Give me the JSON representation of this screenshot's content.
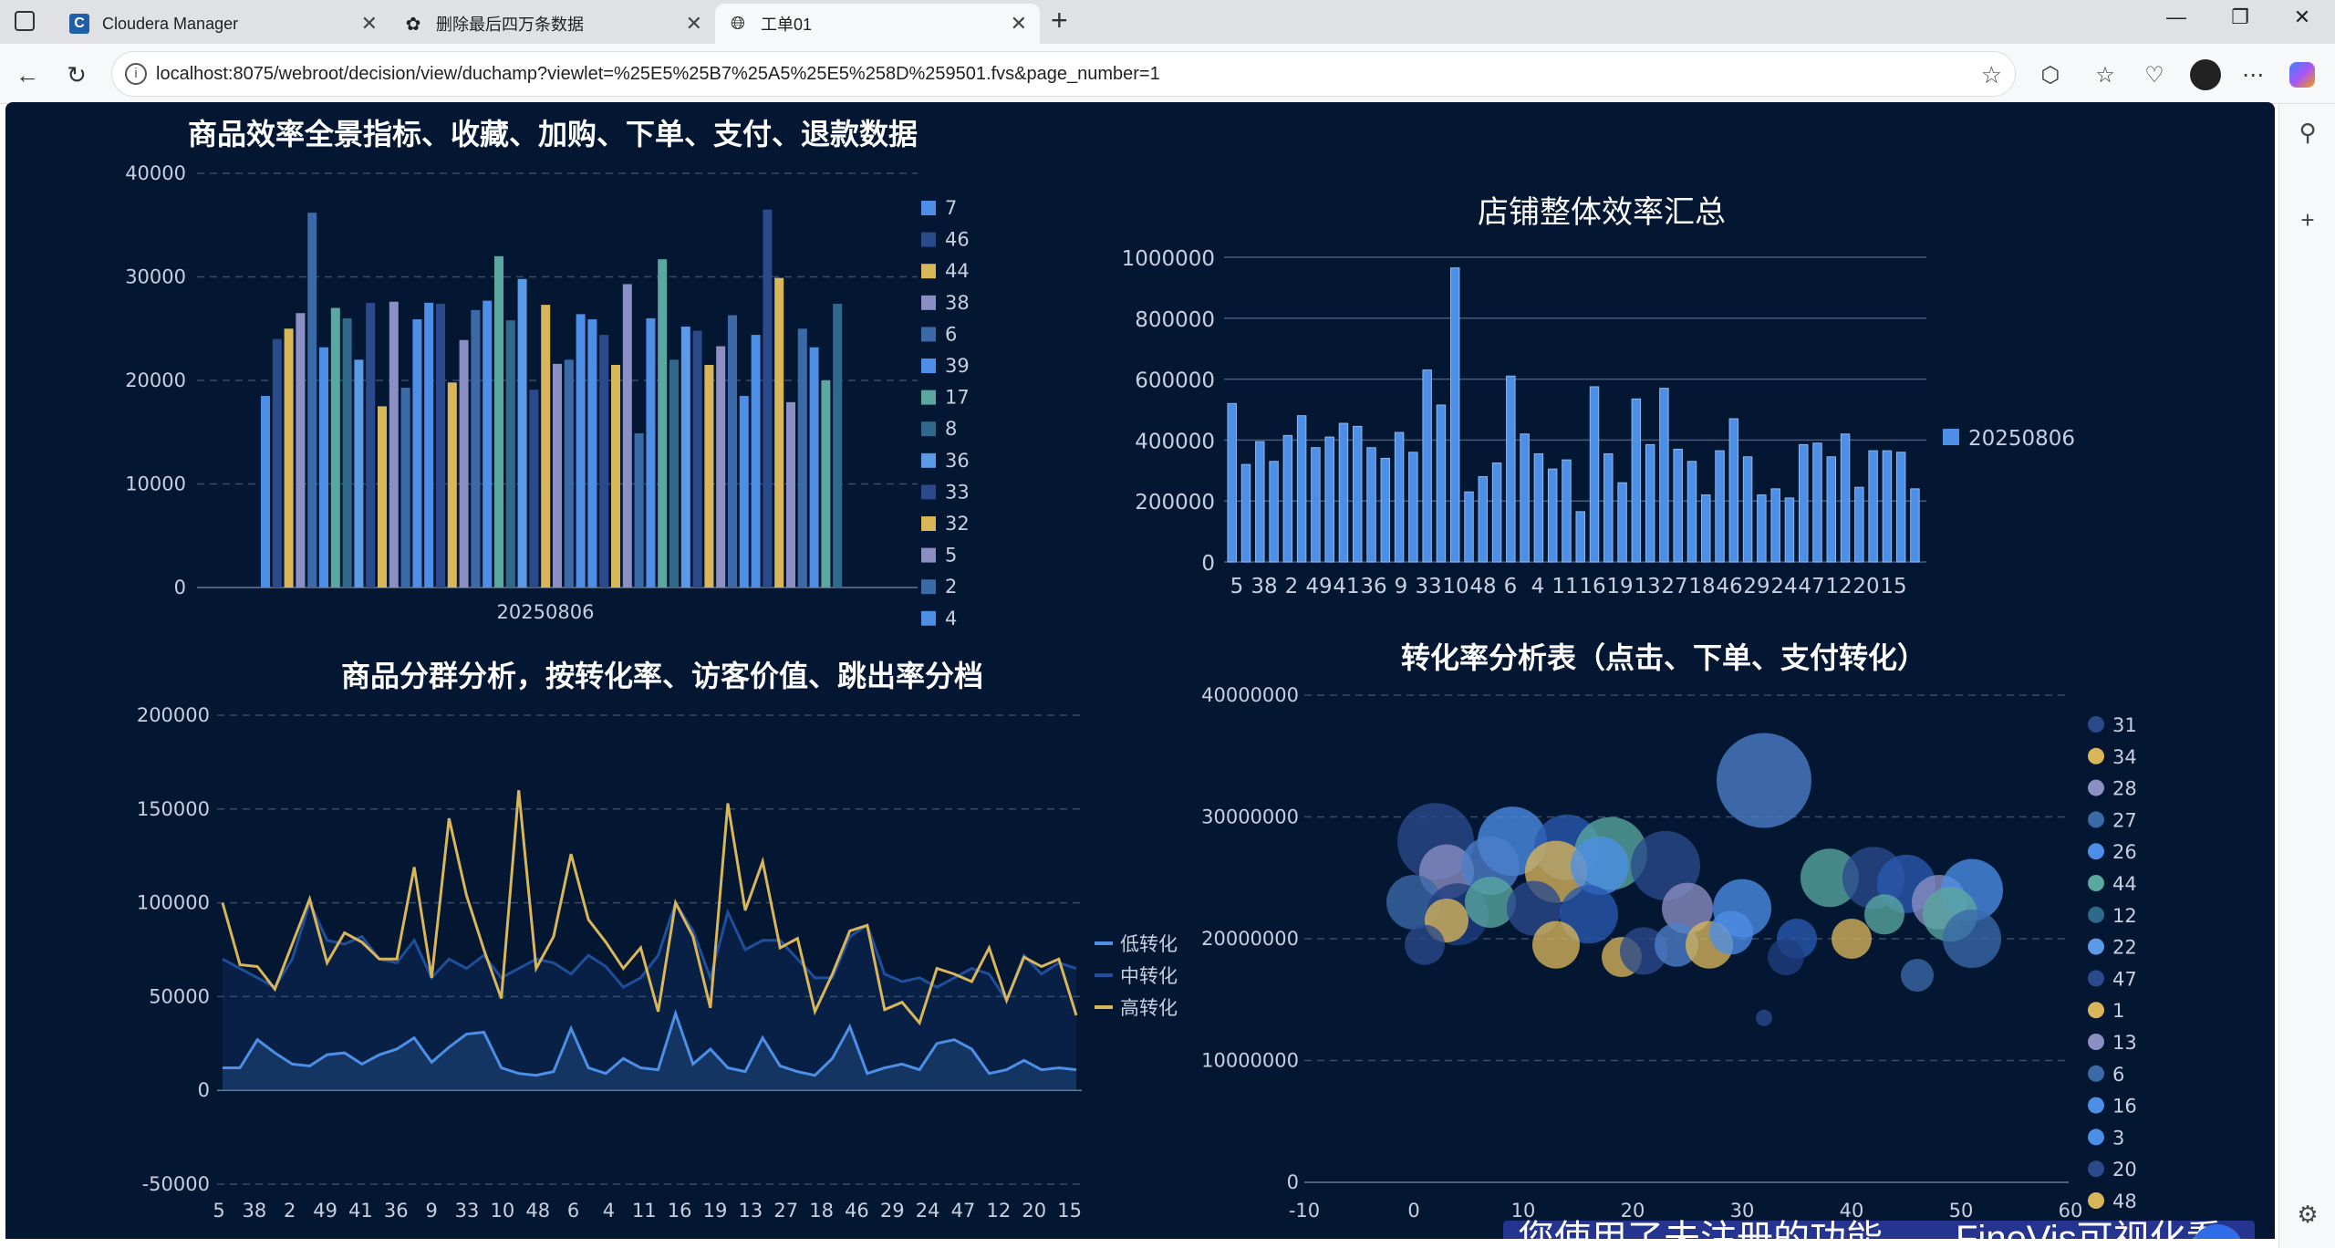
{
  "browser": {
    "tabs": [
      {
        "title": "Cloudera Manager",
        "icon": "cloudera-icon"
      },
      {
        "title": "删除最后四万条数据",
        "icon": "openai-icon"
      },
      {
        "title": "工单01",
        "icon": "globe-icon"
      }
    ],
    "new_tab_label": "+",
    "url": "localhost:8075/webroot/decision/view/duchamp?viewlet=%25E5%25B7%25A5%25E5%258D%259501.fvs&page_number=1"
  },
  "watermark_text": "您使用了未注册的功能——FineVis可视化看板",
  "colors": {
    "background": "#031632",
    "accent_blue": "#4d8ee6",
    "gold": "#d9b65a",
    "teal": "#5aa8a0",
    "lavender": "#8c8fc4",
    "navy": "#2a4a8c"
  },
  "chart_data": [
    {
      "id": "chart1",
      "type": "bar",
      "title": "商品效率全景指标、收藏、加购、下单、支付、退款数据",
      "categories": [
        "20250806"
      ],
      "ylim": [
        0,
        40000
      ],
      "yticks": [
        "40000",
        "30000",
        "20000",
        "10000",
        "0"
      ],
      "grid": true,
      "legend_position": "right",
      "legend": [
        "7",
        "46",
        "44",
        "38",
        "6",
        "39",
        "17",
        "8",
        "36",
        "33",
        "32",
        "5",
        "2",
        "4"
      ],
      "values": [
        18500,
        24000,
        25000,
        26500,
        36200,
        23200,
        27000,
        26000,
        22000,
        27500,
        17500,
        27600,
        19300,
        25900,
        27500,
        27400,
        19800,
        23900,
        26800,
        27700,
        32000,
        25800,
        29800,
        19100,
        27300,
        21600,
        22000,
        26400,
        25900,
        24400,
        21500,
        29300,
        14900,
        26000,
        31700,
        22000,
        25200,
        24800,
        21500,
        23300,
        26300,
        18500,
        24400,
        36500,
        29900,
        17900,
        25000,
        23200,
        20000,
        27400
      ]
    },
    {
      "id": "chart2",
      "type": "bar",
      "title": "店铺整体效率汇总",
      "series_name": "20250806",
      "categories": [
        "5",
        "38",
        "2",
        "49",
        "41",
        "36",
        "9",
        "33",
        "10",
        "48",
        "6",
        "4",
        "11",
        "16",
        "19",
        "13",
        "27",
        "18",
        "46",
        "29",
        "24",
        "47",
        "12",
        "20",
        "15"
      ],
      "ylim": [
        0,
        1000000
      ],
      "yticks": [
        "1000000",
        "800000",
        "600000",
        "400000",
        "200000",
        "0"
      ],
      "grid": true,
      "legend_position": "right",
      "values": [
        520000,
        320000,
        395000,
        330000,
        415000,
        480000,
        375000,
        410000,
        455000,
        445000,
        375000,
        340000,
        425000,
        360000,
        630000,
        515000,
        965000,
        230000,
        280000,
        325000,
        610000,
        420000,
        355000,
        305000,
        335000,
        165000,
        575000,
        355000,
        260000,
        535000,
        385000,
        570000,
        370000,
        330000,
        220000,
        365000,
        470000,
        345000,
        220000,
        240000,
        210000,
        385000,
        390000,
        345000,
        420000,
        245000,
        365000,
        365000,
        360000,
        240000
      ]
    },
    {
      "id": "chart3",
      "type": "line",
      "title": "商品分群分析，按转化率、访客价值、跳出率分档",
      "categories": [
        "5",
        "38",
        "2",
        "49",
        "41",
        "36",
        "9",
        "33",
        "10",
        "48",
        "6",
        "4",
        "11",
        "16",
        "19",
        "13",
        "27",
        "18",
        "46",
        "29",
        "24",
        "47",
        "12",
        "20",
        "15"
      ],
      "ylim": [
        -50000,
        200000
      ],
      "yticks": [
        "200000",
        "150000",
        "100000",
        "50000",
        "0",
        "-50000"
      ],
      "grid": true,
      "legend_position": "right",
      "series": [
        {
          "name": "低转化",
          "color": "#4d8ee6",
          "values": [
            12000,
            12000,
            27000,
            20000,
            14000,
            13000,
            19000,
            20000,
            14000,
            19000,
            22000,
            28000,
            15000,
            23000,
            30000,
            31000,
            12000,
            9000,
            8000,
            10000,
            33000,
            12000,
            9000,
            17000,
            12000,
            11000,
            41000,
            14000,
            22000,
            12000,
            10000,
            28000,
            13000,
            10000,
            8000,
            17000,
            34000,
            9000,
            12000,
            14000,
            11000,
            25000,
            27000,
            22000,
            9000,
            11000,
            16000,
            11000,
            12000,
            11000
          ]
        },
        {
          "name": "中转化",
          "color": "#1f4f9a",
          "values": [
            70000,
            65000,
            60000,
            55000,
            70000,
            100000,
            80000,
            78000,
            82000,
            70000,
            68000,
            80000,
            60000,
            70000,
            65000,
            72000,
            60000,
            65000,
            70000,
            68000,
            62000,
            72000,
            66000,
            55000,
            60000,
            72000,
            100000,
            85000,
            60000,
            95000,
            75000,
            80000,
            80000,
            70000,
            60000,
            60000,
            82000,
            88000,
            62000,
            58000,
            60000,
            55000,
            60000,
            65000,
            62000,
            48000,
            72000,
            62000,
            68000,
            65000
          ]
        },
        {
          "name": "高转化",
          "color": "#d9b65a",
          "values": [
            100000,
            67000,
            66000,
            54000,
            78000,
            102000,
            68000,
            84000,
            79000,
            70000,
            70000,
            119000,
            60000,
            145000,
            104000,
            75000,
            49000,
            160000,
            65000,
            82000,
            126000,
            91000,
            79000,
            65000,
            76000,
            42000,
            100000,
            82000,
            44000,
            153000,
            96000,
            122000,
            76000,
            81000,
            42000,
            62000,
            85000,
            88000,
            43000,
            47000,
            36000,
            65000,
            62000,
            58000,
            76000,
            48000,
            71000,
            66000,
            70000,
            40000
          ]
        }
      ]
    },
    {
      "id": "chart4",
      "type": "scatter",
      "title": "转化率分析表（点击、下单、支付转化）",
      "xlim": [
        -10,
        60
      ],
      "xticks": [
        "-10",
        "0",
        "10",
        "20",
        "30",
        "40",
        "50",
        "60"
      ],
      "ylim": [
        0,
        40000000
      ],
      "yticks": [
        "40000000",
        "30000000",
        "20000000",
        "10000000",
        "0"
      ],
      "grid": true,
      "legend_position": "right",
      "legend": [
        "31",
        "34",
        "28",
        "27",
        "26",
        "44",
        "12",
        "22",
        "47",
        "1",
        "13",
        "6",
        "16",
        "3",
        "20",
        "48"
      ],
      "points": [
        {
          "x": 32,
          "y": 33000000,
          "r": 52,
          "c": "#4d7fc9"
        },
        {
          "x": 2,
          "y": 28000000,
          "r": 42,
          "c": "#2a4a8c"
        },
        {
          "x": 9,
          "y": 28000000,
          "r": 38,
          "c": "#4d8ee6"
        },
        {
          "x": 14,
          "y": 27500000,
          "r": 36,
          "c": "#2a5ab0"
        },
        {
          "x": 18,
          "y": 27000000,
          "r": 40,
          "c": "#5aa8a0"
        },
        {
          "x": 13,
          "y": 25500000,
          "r": 34,
          "c": "#d9b65a"
        },
        {
          "x": 17,
          "y": 26000000,
          "r": 32,
          "c": "#4d8ee6"
        },
        {
          "x": 23,
          "y": 26000000,
          "r": 38,
          "c": "#2a4a8c"
        },
        {
          "x": 3,
          "y": 25500000,
          "r": 30,
          "c": "#8c8fc4"
        },
        {
          "x": 7,
          "y": 26000000,
          "r": 32,
          "c": "#4d7fc9"
        },
        {
          "x": 0,
          "y": 23000000,
          "r": 30,
          "c": "#3a6aa8"
        },
        {
          "x": 4,
          "y": 22000000,
          "r": 34,
          "c": "#1f3f80"
        },
        {
          "x": 7,
          "y": 23000000,
          "r": 28,
          "c": "#5aa8a0"
        },
        {
          "x": 11,
          "y": 22500000,
          "r": 30,
          "c": "#2a4a8c"
        },
        {
          "x": 16,
          "y": 22000000,
          "r": 32,
          "c": "#2a5ab0"
        },
        {
          "x": 25,
          "y": 22500000,
          "r": 28,
          "c": "#8c8fc4"
        },
        {
          "x": 30,
          "y": 22500000,
          "r": 32,
          "c": "#4d8ee6"
        },
        {
          "x": 38,
          "y": 25000000,
          "r": 32,
          "c": "#5aa8a0"
        },
        {
          "x": 42,
          "y": 25000000,
          "r": 34,
          "c": "#2a4a8c"
        },
        {
          "x": 45,
          "y": 24500000,
          "r": 32,
          "c": "#2a5ab0"
        },
        {
          "x": 48,
          "y": 23000000,
          "r": 30,
          "c": "#8c8fc4"
        },
        {
          "x": 51,
          "y": 24000000,
          "r": 34,
          "c": "#4d8ee6"
        },
        {
          "x": 49,
          "y": 22000000,
          "r": 30,
          "c": "#5aa8a0"
        },
        {
          "x": 51,
          "y": 20000000,
          "r": 32,
          "c": "#3a6aa8"
        },
        {
          "x": 3,
          "y": 21500000,
          "r": 24,
          "c": "#d9b65a"
        },
        {
          "x": 13,
          "y": 19500000,
          "r": 26,
          "c": "#d9b65a"
        },
        {
          "x": 19,
          "y": 18500000,
          "r": 22,
          "c": "#d9b65a"
        },
        {
          "x": 21,
          "y": 19000000,
          "r": 26,
          "c": "#2a4a8c"
        },
        {
          "x": 24,
          "y": 19500000,
          "r": 24,
          "c": "#4d7fc9"
        },
        {
          "x": 27,
          "y": 19500000,
          "r": 26,
          "c": "#d9b65a"
        },
        {
          "x": 29,
          "y": 20500000,
          "r": 24,
          "c": "#4d8ee6"
        },
        {
          "x": 35,
          "y": 20000000,
          "r": 22,
          "c": "#2a5ab0"
        },
        {
          "x": 40,
          "y": 20000000,
          "r": 22,
          "c": "#d9b65a"
        },
        {
          "x": 43,
          "y": 22000000,
          "r": 22,
          "c": "#5aa8a0"
        },
        {
          "x": 1,
          "y": 19500000,
          "r": 22,
          "c": "#2a4a8c"
        },
        {
          "x": 34,
          "y": 18500000,
          "r": 20,
          "c": "#1f3f80"
        },
        {
          "x": 46,
          "y": 17000000,
          "r": 18,
          "c": "#3a6aa8"
        },
        {
          "x": 32,
          "y": 13500000,
          "r": 9,
          "c": "#2a4a8c"
        }
      ]
    }
  ]
}
